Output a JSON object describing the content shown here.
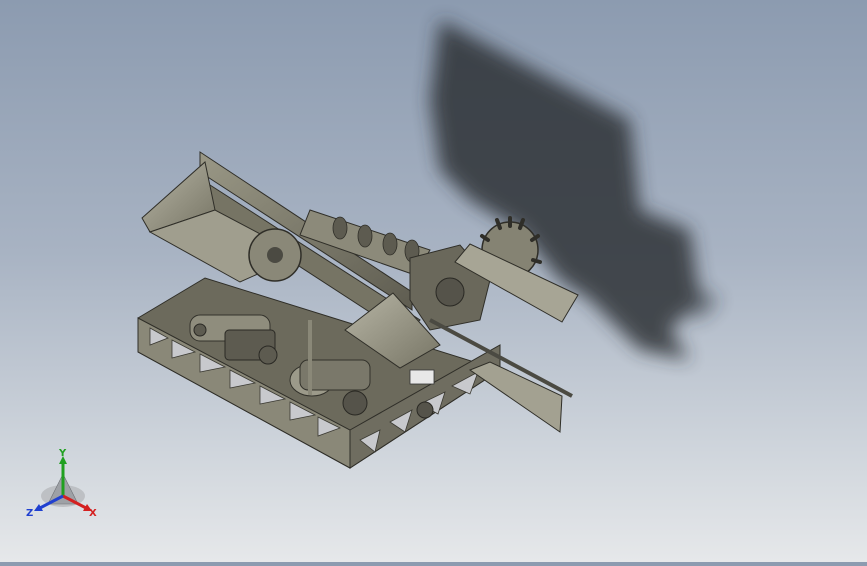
{
  "viewport": {
    "background_top": "#8c9bb0",
    "background_bottom": "#e6e8ea",
    "model_color": "#7e7c6c",
    "shadow_color": "#2a2d33"
  },
  "triad": {
    "x_label": "X",
    "y_label": "Y",
    "z_label": "Z",
    "x_color": "#d42020",
    "y_color": "#20a020",
    "z_color": "#2040d0"
  }
}
